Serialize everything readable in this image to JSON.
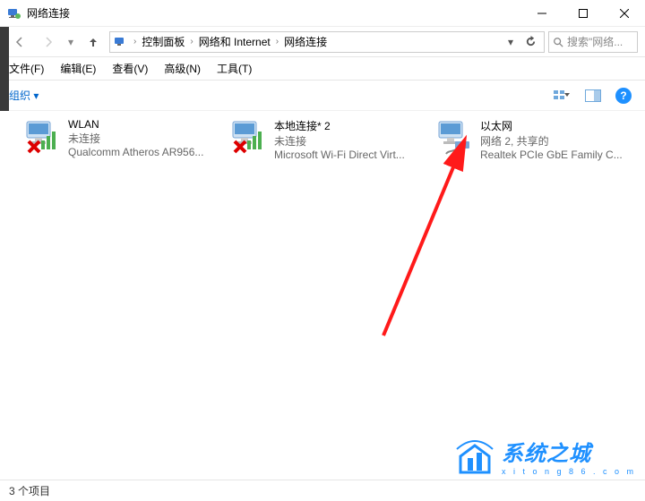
{
  "window": {
    "title": "网络连接"
  },
  "breadcrumb": {
    "root": "控制面板",
    "mid": "网络和 Internet",
    "leaf": "网络连接"
  },
  "search": {
    "placeholder": "搜索\"网络..."
  },
  "menu": {
    "file": "文件(F)",
    "edit": "编辑(E)",
    "view": "查看(V)",
    "advanced": "高级(N)",
    "tools": "工具(T)"
  },
  "toolbar": {
    "organize": "组织 ▾"
  },
  "connections": [
    {
      "name": "WLAN",
      "status": "未连接",
      "device": "Qualcomm Atheros AR956...",
      "disabled": true
    },
    {
      "name": "本地连接* 2",
      "status": "未连接",
      "device": "Microsoft Wi-Fi Direct Virt...",
      "disabled": true
    },
    {
      "name": "以太网",
      "status": "网络 2, 共享的",
      "device": "Realtek PCIe GbE Family C...",
      "disabled": false
    }
  ],
  "statusbar": {
    "count": "3 个项目"
  },
  "watermark": {
    "cn": "系统之城",
    "en": "x i t o n g 8 6 . c o m"
  }
}
